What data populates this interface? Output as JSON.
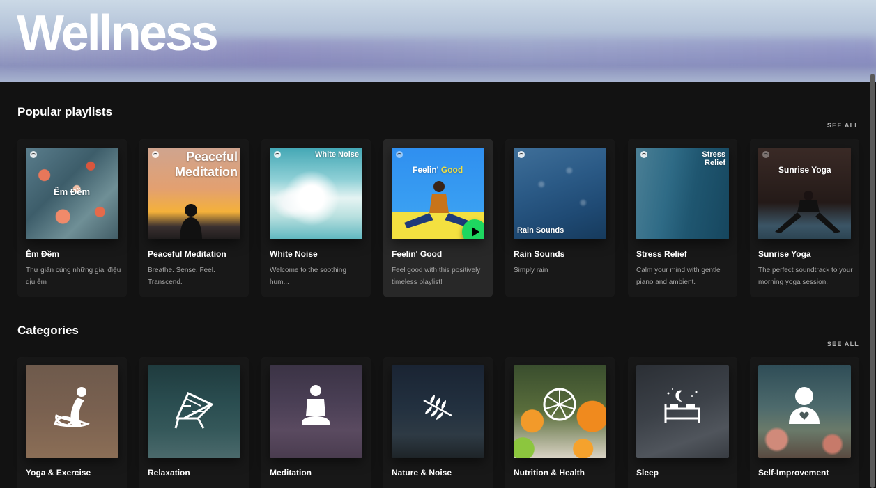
{
  "hero": {
    "title": "Wellness"
  },
  "popular": {
    "title": "Popular playlists",
    "see_all": "SEE ALL",
    "items": [
      {
        "name": "Êm Đềm",
        "desc": "Thư giãn cùng những giai điệu dịu êm",
        "art_text": "Êm Đềm"
      },
      {
        "name": "Peaceful Meditation",
        "desc": "Breathe. Sense. Feel. Transcend.",
        "art_text": "Peaceful Meditation"
      },
      {
        "name": "White Noise",
        "desc": "Welcome to the soothing hum...",
        "art_text": "White Noise"
      },
      {
        "name": "Feelin' Good",
        "desc": "Feel good with this positively timeless playlist!",
        "art_text_a": "Feelin'",
        "art_text_b": "Good"
      },
      {
        "name": "Rain Sounds",
        "desc": "Simply rain",
        "art_text": "Rain Sounds"
      },
      {
        "name": "Stress Relief",
        "desc": "Calm your mind with gentle piano and ambient.",
        "art_text": "Stress Relief"
      },
      {
        "name": "Sunrise Yoga",
        "desc": "The perfect soundtrack to your morning yoga session.",
        "art_text": "Sunrise Yoga"
      }
    ]
  },
  "categories": {
    "title": "Categories",
    "see_all": "SEE ALL",
    "items": [
      {
        "name": "Yoga & Exercise",
        "icon": "yoga-pose-icon"
      },
      {
        "name": "Relaxation",
        "icon": "beach-chair-icon"
      },
      {
        "name": "Meditation",
        "icon": "meditating-person-icon"
      },
      {
        "name": "Nature & Noise",
        "icon": "leaf-branch-icon"
      },
      {
        "name": "Nutrition & Health",
        "icon": "citrus-slice-icon"
      },
      {
        "name": "Sleep",
        "icon": "bed-moon-icon"
      },
      {
        "name": "Self-Improvement",
        "icon": "person-heart-icon"
      }
    ]
  }
}
